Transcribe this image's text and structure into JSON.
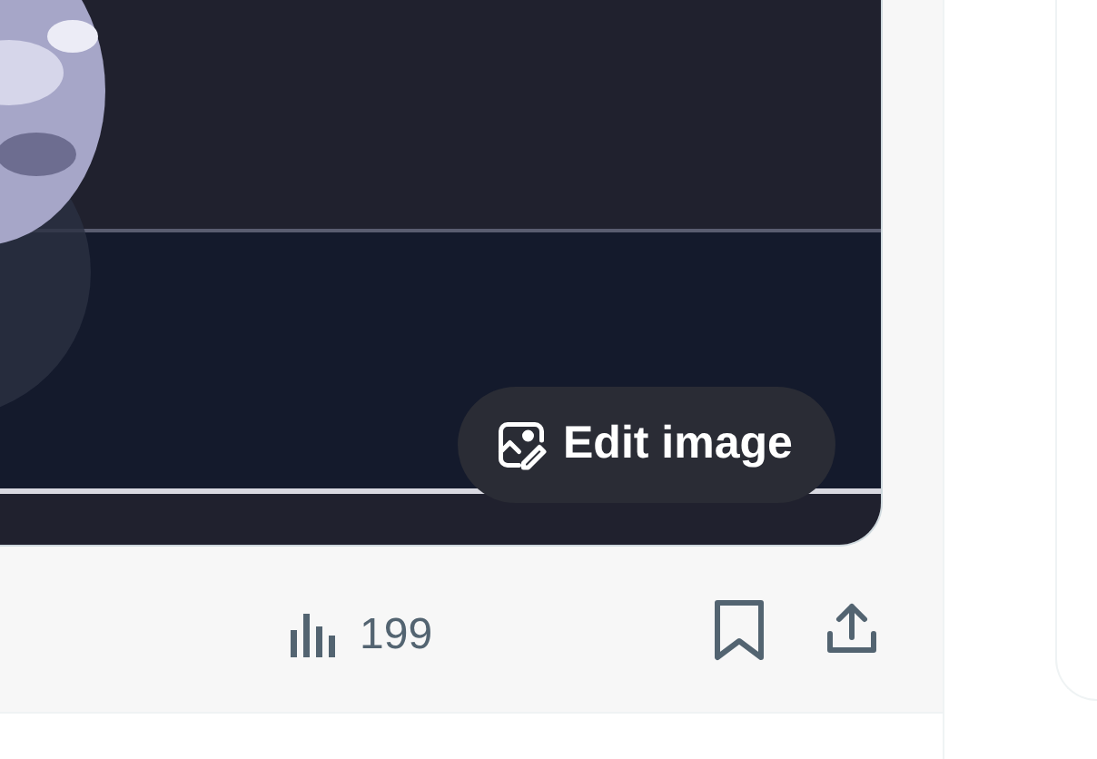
{
  "post": {
    "image": {
      "kind": "picture",
      "edit_button": "Edit image"
    },
    "views": "199"
  }
}
